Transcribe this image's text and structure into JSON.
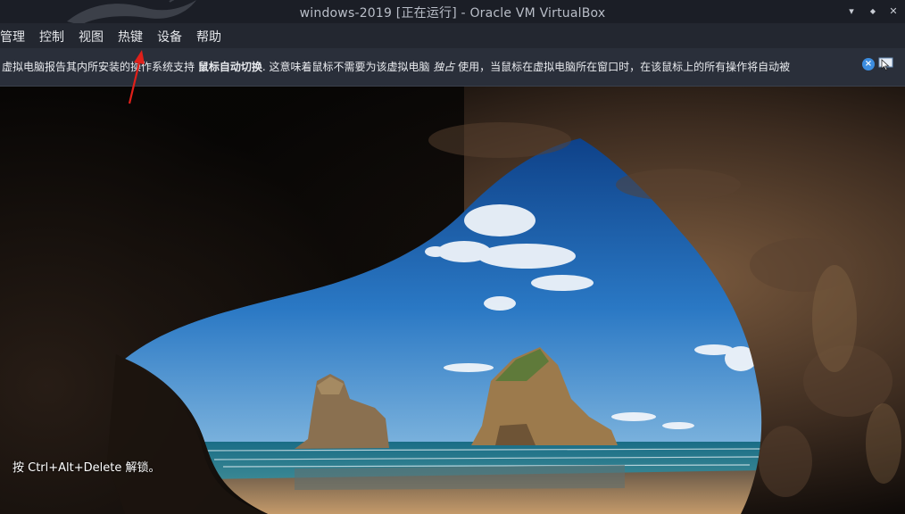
{
  "window": {
    "title": "windows-2019 [正在运行] - Oracle VM VirtualBox",
    "controls": {
      "minimize": "▾",
      "maximize": "◆",
      "close": "✕"
    }
  },
  "menu": {
    "items": [
      {
        "label": "管理"
      },
      {
        "label": "控制"
      },
      {
        "label": "视图"
      },
      {
        "label": "热键"
      },
      {
        "label": "设备"
      },
      {
        "label": "帮助"
      }
    ]
  },
  "notification": {
    "text_pre": "虚拟电脑报告其内所安装的操作系统支持 ",
    "text_bold": "鼠标自动切换",
    "text_mid": ". 这意味着鼠标不需要为该虚拟电脑 ",
    "text_italic": "独占",
    "text_post": " 使用，当鼠标在虚拟电脑所在窗口时，在该鼠标上的所有操作将自动被",
    "close_icon": "close-icon",
    "mouse_icon": "mouse-integration-icon"
  },
  "guest": {
    "lock_hint": "按 Ctrl+Alt+Delete 解锁。"
  },
  "colors": {
    "titlebar": "#1b1e26",
    "menubar": "#232730",
    "notice": "#2a2f3a",
    "annotation_arrow": "#e0201a"
  }
}
